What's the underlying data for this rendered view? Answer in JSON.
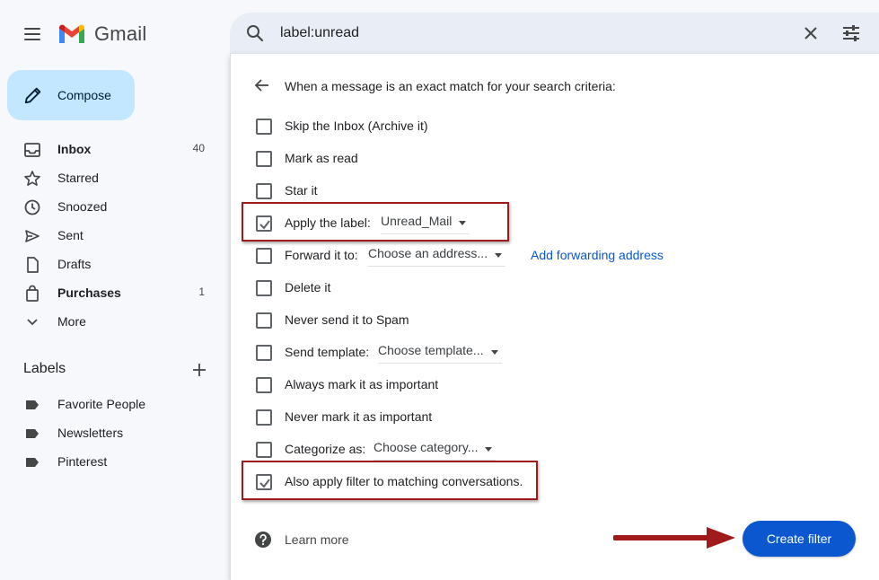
{
  "header": {
    "app_name": "Gmail",
    "search_value": "label:unread"
  },
  "sidebar": {
    "compose_label": "Compose",
    "items": [
      {
        "label": "Inbox",
        "count": "40"
      },
      {
        "label": "Starred",
        "count": ""
      },
      {
        "label": "Snoozed",
        "count": ""
      },
      {
        "label": "Sent",
        "count": ""
      },
      {
        "label": "Drafts",
        "count": ""
      },
      {
        "label": "Purchases",
        "count": "1"
      },
      {
        "label": "More",
        "count": ""
      }
    ],
    "labels_title": "Labels",
    "labels": [
      "Favorite People",
      "Newsletters",
      "Pinterest"
    ]
  },
  "dialog": {
    "heading": "When a message is an exact match for your search criteria:",
    "options": [
      {
        "label": "Skip the Inbox (Archive it)",
        "checked": false
      },
      {
        "label": "Mark as read",
        "checked": false
      },
      {
        "label": "Star it",
        "checked": false
      },
      {
        "label": "Apply the label:",
        "checked": true,
        "dropdown": "Unread_Mail"
      },
      {
        "label": "Forward it to:",
        "checked": false,
        "dropdown": "Choose an address...",
        "link": "Add forwarding address"
      },
      {
        "label": "Delete it",
        "checked": false
      },
      {
        "label": "Never send it to Spam",
        "checked": false
      },
      {
        "label": "Send template:",
        "checked": false,
        "dropdown": "Choose template..."
      },
      {
        "label": "Always mark it as important",
        "checked": false
      },
      {
        "label": "Never mark it as important",
        "checked": false
      },
      {
        "label": "Categorize as:",
        "checked": false,
        "dropdown": "Choose category..."
      },
      {
        "label": "Also apply filter to matching conversations.",
        "checked": true
      }
    ],
    "learn_more": "Learn more",
    "create_button": "Create filter"
  },
  "colors": {
    "accent": "#0b57d0",
    "compose_bg": "#c2e7ff",
    "annotation": "#a01c1c"
  }
}
